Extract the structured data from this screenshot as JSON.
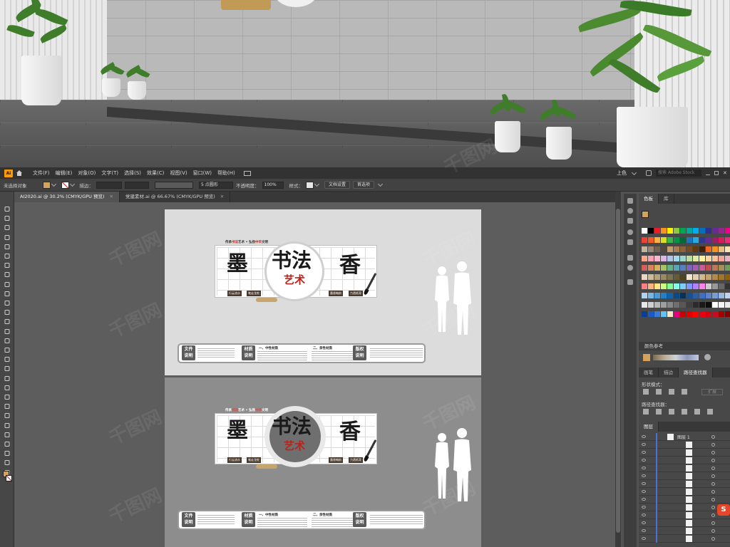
{
  "menubar": {
    "app_badge": "Ai",
    "items": [
      "文件(F)",
      "编辑(E)",
      "对象(O)",
      "文字(T)",
      "选择(S)",
      "效果(C)",
      "视图(V)",
      "窗口(W)",
      "帮助(H)"
    ],
    "workspace": "上色",
    "stock_placeholder": "搜索 Adobe Stock"
  },
  "control": {
    "selection_status": "未选择对象",
    "stroke_label": "描边：",
    "brush_value": "5 点圆形",
    "opacity_label": "不透明度：",
    "opacity_value": "100%",
    "style_label": "样式：",
    "doc_setup": "文档设置",
    "preferences": "首选项"
  },
  "tabs": [
    {
      "label": "AI2020.ai @ 30.2% (CMYK/GPU 预览)",
      "active": true
    },
    {
      "label": "党建素材.ai @ 66.67% (CMYK/GPU 预览)",
      "active": false
    }
  ],
  "panels": {
    "swatch_tabs": [
      "色板",
      "库"
    ],
    "color_guide": "颜色参考",
    "mid_tabs": [
      "画笔",
      "描边",
      "路径查找器"
    ],
    "shape_modes": "形状模式：",
    "expand_btn": "扩展",
    "pathfinder": "路径查找器：",
    "layers_tab": "图层",
    "layer_name": "图层 1"
  },
  "design": {
    "tagline_prefix": "传承",
    "tagline_red1": "书法",
    "tagline_mid": "艺术 • 弘扬",
    "tagline_red2": "中华",
    "tagline_suffix": "文明",
    "char_mo": "墨",
    "char_shufa": "书法",
    "char_yishu": "艺术",
    "char_xiang": "香",
    "labels": [
      "行云流水",
      "笔走龙蛇",
      "墨香翰韵",
      "力透纸背"
    ],
    "info_heads": [
      "文件\n说明",
      "材质\n说明",
      "版权\n说明"
    ],
    "info_titles": [
      "一、中性材质",
      "二、亲性材质"
    ]
  },
  "watermark": "千图网",
  "colors": {
    "ai_orange": "#ff9a00",
    "fill_swatch": "#d4a25a",
    "red_accent": "#b8231b",
    "brown_label": "#4a3a2e"
  }
}
